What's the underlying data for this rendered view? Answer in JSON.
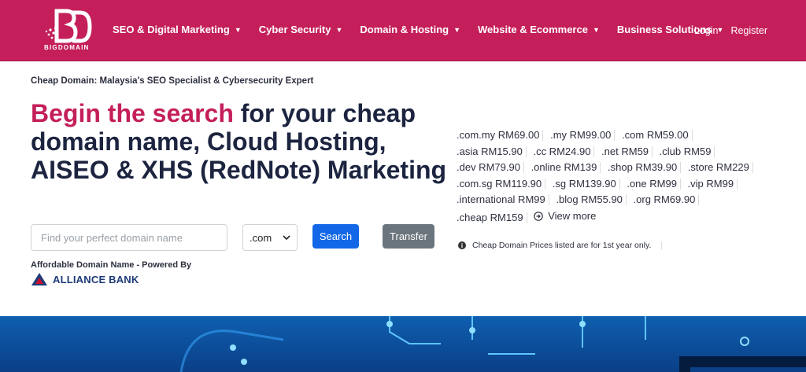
{
  "brand": {
    "logo_text": "BIGDOMAIN",
    "color": "#c41f5a"
  },
  "nav": {
    "items": [
      {
        "label": "SEO & Digital Marketing"
      },
      {
        "label": "Cyber Security"
      },
      {
        "label": "Domain & Hosting"
      },
      {
        "label": "Website & Ecommerce"
      },
      {
        "label": "Business Solutions"
      }
    ],
    "login": "Login",
    "register": "Register"
  },
  "hero": {
    "kicker": "Cheap Domain: Malaysia's SEO Specialist & Cybersecurity Expert",
    "headline_accent": "Begin the search",
    "headline_rest": " for your cheap domain name, Cloud Hosting, AISEO & XHS (RedNote) Marketing"
  },
  "search": {
    "placeholder": "Find your perfect domain name",
    "tld_selected": ".com",
    "search_label": "Search",
    "transfer_label": "Transfer"
  },
  "powered": {
    "text": "Affordable Domain Name - Powered By",
    "bank_name": "ALLIANCE BANK"
  },
  "prices": [
    ".com.my RM69.00",
    ".my RM99.00",
    ".com RM59.00",
    ".asia RM15.90",
    ".cc RM24.90",
    ".net RM59",
    ".club RM59",
    ".dev RM79.90",
    ".online RM139",
    ".shop RM39.90",
    ".store RM229",
    ".com.sg RM119.90",
    ".sg RM139.90",
    ".one RM99",
    ".vip RM99",
    ".international RM99",
    ".blog RM55.90",
    ".org RM69.90",
    ".cheap RM159"
  ],
  "view_more": "View more",
  "note": "Cheap Domain Prices listed are for 1st year only."
}
